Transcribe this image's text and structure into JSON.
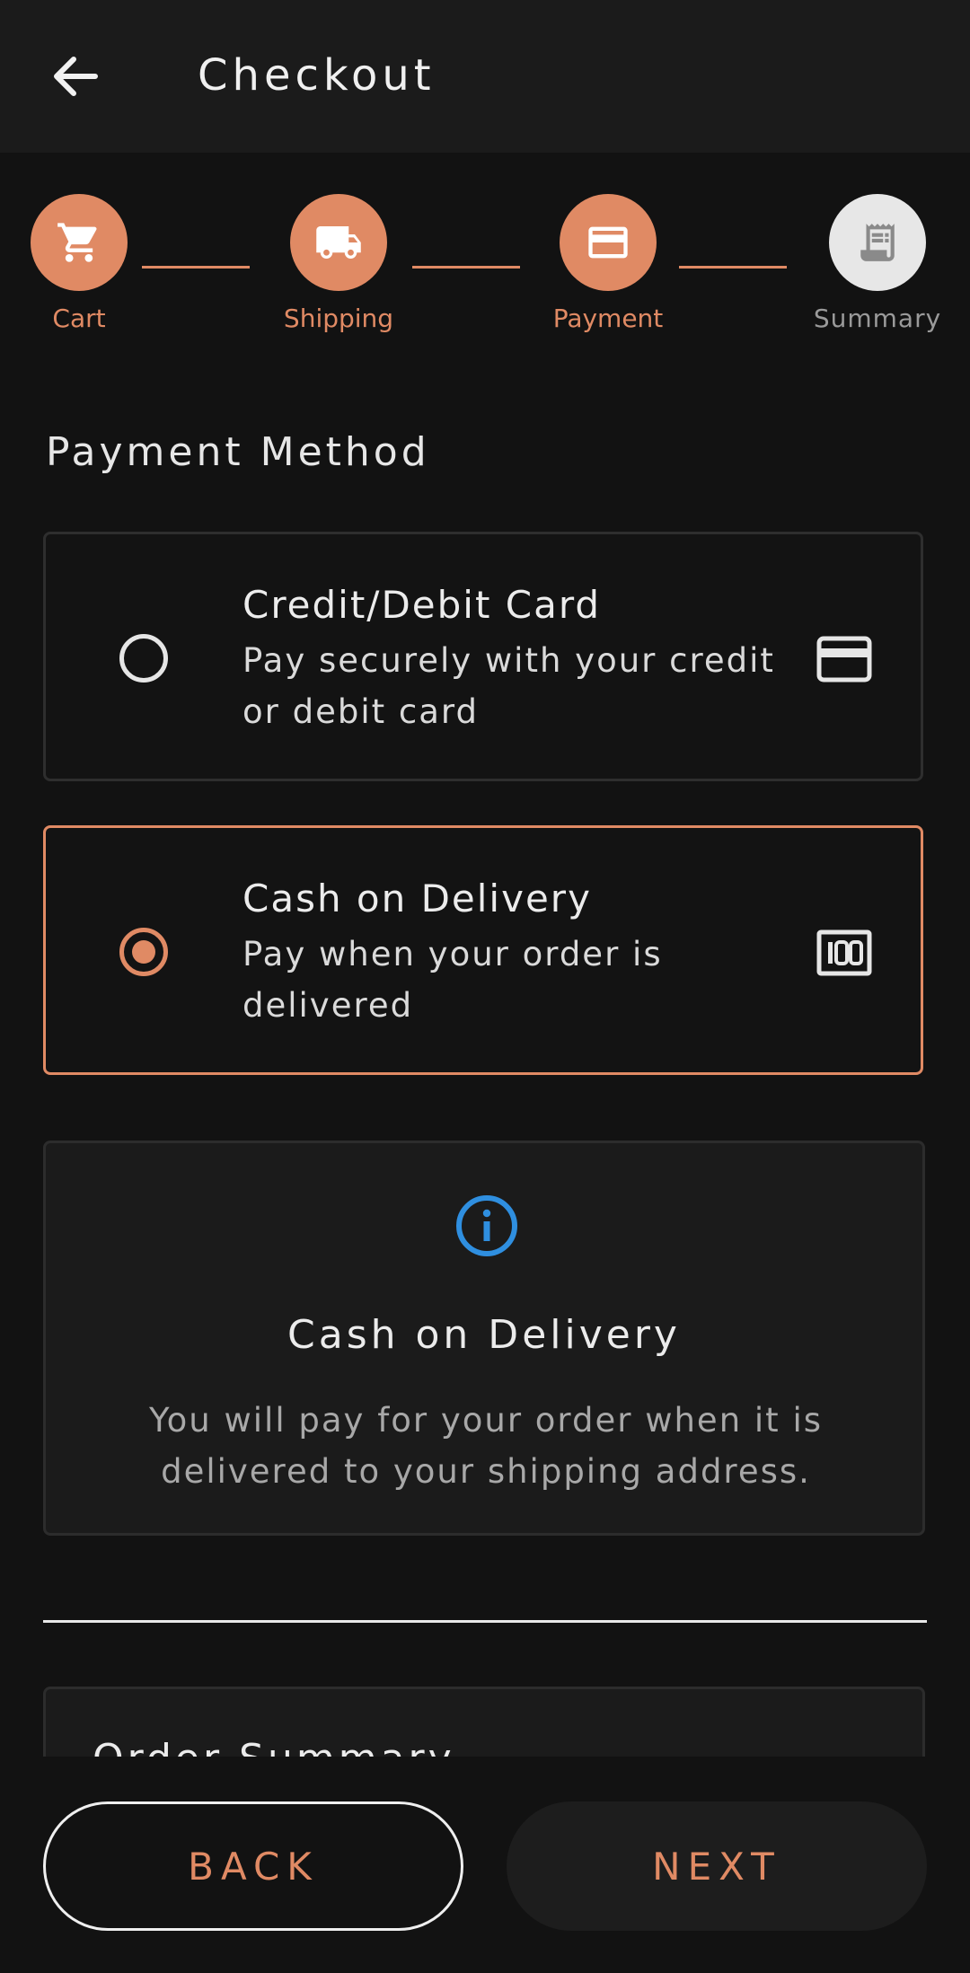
{
  "app_bar": {
    "title": "Checkout",
    "back_icon": "arrow-left-icon"
  },
  "stepper": {
    "steps": [
      {
        "label": "Cart",
        "icon": "cart-icon",
        "state": "complete"
      },
      {
        "label": "Shipping",
        "icon": "truck-icon",
        "state": "complete"
      },
      {
        "label": "Payment",
        "icon": "credit-card-icon",
        "state": "active"
      },
      {
        "label": "Summary",
        "icon": "receipt-icon",
        "state": "inactive"
      }
    ]
  },
  "payment": {
    "section_title": "Payment Method",
    "options": [
      {
        "title": "Credit/Debit Card",
        "description": "Pay securely with your credit or debit card",
        "icon": "credit-card-icon",
        "selected": false
      },
      {
        "title": "Cash on Delivery",
        "description": "Pay when your order is delivered",
        "icon": "money-icon",
        "selected": true
      }
    ]
  },
  "info_card": {
    "icon": "info-icon",
    "title": "Cash on Delivery",
    "text": "You will pay for your order when it is delivered to your shipping address."
  },
  "summary": {
    "title": "Order Summary"
  },
  "actions": {
    "back_label": "BACK",
    "next_label": "NEXT"
  },
  "colors": {
    "accent": "#e08a64",
    "background": "#121212",
    "surface": "#1b1b1b",
    "info_blue": "#2f8fe0",
    "inactive_step": "#e7e7e7"
  }
}
